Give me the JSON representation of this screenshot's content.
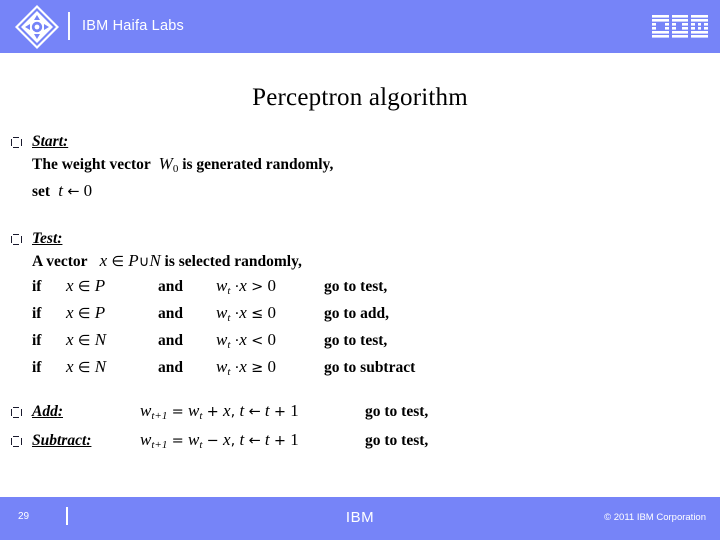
{
  "colors": {
    "band": "#7684f8",
    "band_text": "#ffffff",
    "body_bg": "#ffffff",
    "body_text": "#000000"
  },
  "header": {
    "logo_icon": "ibm-haifa-diamond-logo",
    "title": "IBM Haifa Labs",
    "brand_icon": "ibm-striped-logo"
  },
  "slide": {
    "title": "Perceptron algorithm",
    "bullet_icon": "square-bullet-glyph",
    "blocks": [
      {
        "heading": "Start:",
        "lines": [
          {
            "prefix": "The weight vector",
            "var": "W",
            "sub": "0",
            "suffix": "is generated randomly,"
          },
          {
            "prefix": "set",
            "var": "t",
            "op": "←",
            "value": "0"
          }
        ]
      },
      {
        "heading": "Test:",
        "intro": {
          "prefix": "A vector",
          "var": "x",
          "member": "∈",
          "set_a": "P",
          "union": "∪",
          "set_b": "N",
          "suffix": "is selected randomly,"
        },
        "conditions": [
          {
            "if": "if",
            "var": "x",
            "member": "∈",
            "set": "P",
            "and": "and",
            "w": "w",
            "sub": "t",
            "dot": "·",
            "x": "x",
            "rel": ">",
            "zero": "0",
            "goto": "go to test,"
          },
          {
            "if": "if",
            "var": "x",
            "member": "∈",
            "set": "P",
            "and": "and",
            "w": "w",
            "sub": "t",
            "dot": "·",
            "x": "x",
            "rel": "≤",
            "zero": "0",
            "goto": "go to add,"
          },
          {
            "if": "if",
            "var": "x",
            "member": "∈",
            "set": "N",
            "and": "and",
            "w": "w",
            "sub": "t",
            "dot": "·",
            "x": "x",
            "rel": "<",
            "zero": "0",
            "goto": "go to test,"
          },
          {
            "if": "if",
            "var": "x",
            "member": "∈",
            "set": "N",
            "and": "and",
            "w": "w",
            "sub": "t",
            "dot": "·",
            "x": "x",
            "rel": "≥",
            "zero": "0",
            "goto": "go to subtract"
          }
        ]
      }
    ],
    "tail": [
      {
        "heading": "Add:",
        "equation": {
          "w_new": "w",
          "sub_new": "t+1",
          "eq": "=",
          "w_old": "w",
          "sub_old": "t",
          "sign": "+",
          "x": "x",
          "comma": ",",
          "t": "t",
          "arrow": "←",
          "t2": "t",
          "plus": "+",
          "one": "1"
        },
        "goto": "go to test,"
      },
      {
        "heading": "Subtract:",
        "equation": {
          "w_new": "w",
          "sub_new": "t+1",
          "eq": "=",
          "w_old": "w",
          "sub_old": "t",
          "sign": "−",
          "x": "x",
          "comma": ",",
          "t": "t",
          "arrow": "←",
          "t2": "t",
          "plus": "+",
          "one": "1"
        },
        "goto": "go to test,"
      }
    ]
  },
  "footer": {
    "page_number": "29",
    "center_label": "IBM",
    "copyright": "© 2011 IBM Corporation"
  }
}
